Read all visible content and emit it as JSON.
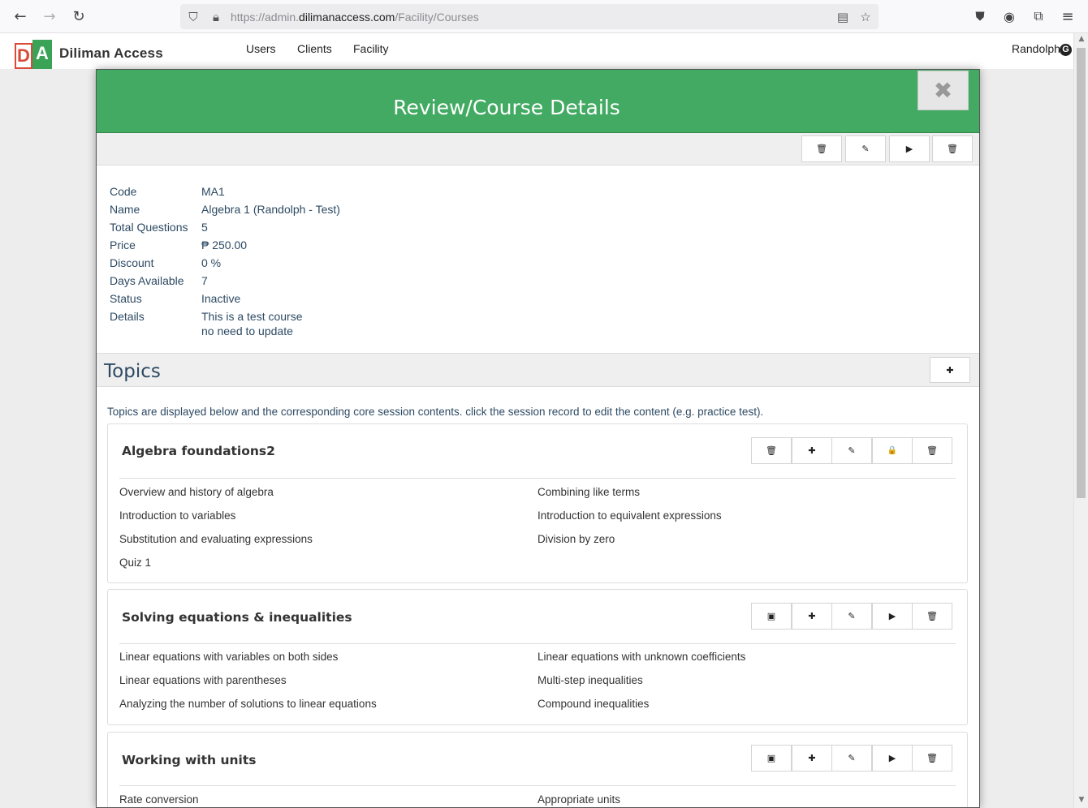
{
  "browser": {
    "url_prefix": "https://admin.",
    "url_domain": "dilimanaccess.com",
    "url_path": "/Facility/Courses"
  },
  "app": {
    "brand": "Diliman Access",
    "logo_letters": [
      "D",
      "A"
    ],
    "nav": [
      "Users",
      "Clients",
      "Facility"
    ],
    "user": "Randolph",
    "user_badge": "G"
  },
  "modal": {
    "title": "Review/Course Details",
    "close_label": "✖"
  },
  "course": {
    "fields": [
      {
        "label": "Code",
        "value": "MA1"
      },
      {
        "label": "Name",
        "value": "Algebra 1 (Randolph - Test)"
      },
      {
        "label": "Total Questions",
        "value": "5"
      },
      {
        "label": "Price",
        "value": "₱ 250.00"
      },
      {
        "label": "Discount",
        "value": "0 %"
      },
      {
        "label": "Days Available",
        "value": "7"
      },
      {
        "label": "Status",
        "value": "Inactive"
      },
      {
        "label": "Details",
        "value": "This is a test course",
        "value2": "no need to update"
      }
    ]
  },
  "topics": {
    "heading": "Topics",
    "intro": "Topics are displayed below and the corresponding core session contents. click the session record to edit the content (e.g. practice test).",
    "items": [
      {
        "name": "Algebra foundations2",
        "sessions_left": [
          "Overview and history of algebra",
          "Introduction to variables",
          "Substitution and evaluating expressions",
          "Quiz 1"
        ],
        "sessions_right": [
          "Combining like terms",
          "Introduction to equivalent expressions",
          "Division by zero"
        ]
      },
      {
        "name": "Solving equations & inequalities",
        "sessions_left": [
          "Linear equations with variables on both sides",
          "Linear equations with parentheses",
          "Analyzing the number of solutions to linear equations"
        ],
        "sessions_right": [
          "Linear equations with unknown coefficients",
          "Multi-step inequalities",
          "Compound inequalities"
        ]
      },
      {
        "name": "Working with units",
        "sessions_left": [
          "Rate conversion"
        ],
        "sessions_right": [
          "Appropriate units"
        ]
      }
    ]
  },
  "icons": {
    "trash": "🗑",
    "pencil": "✎",
    "play": "▶",
    "plus": "✚",
    "lock": "🔒",
    "image": "▣"
  }
}
